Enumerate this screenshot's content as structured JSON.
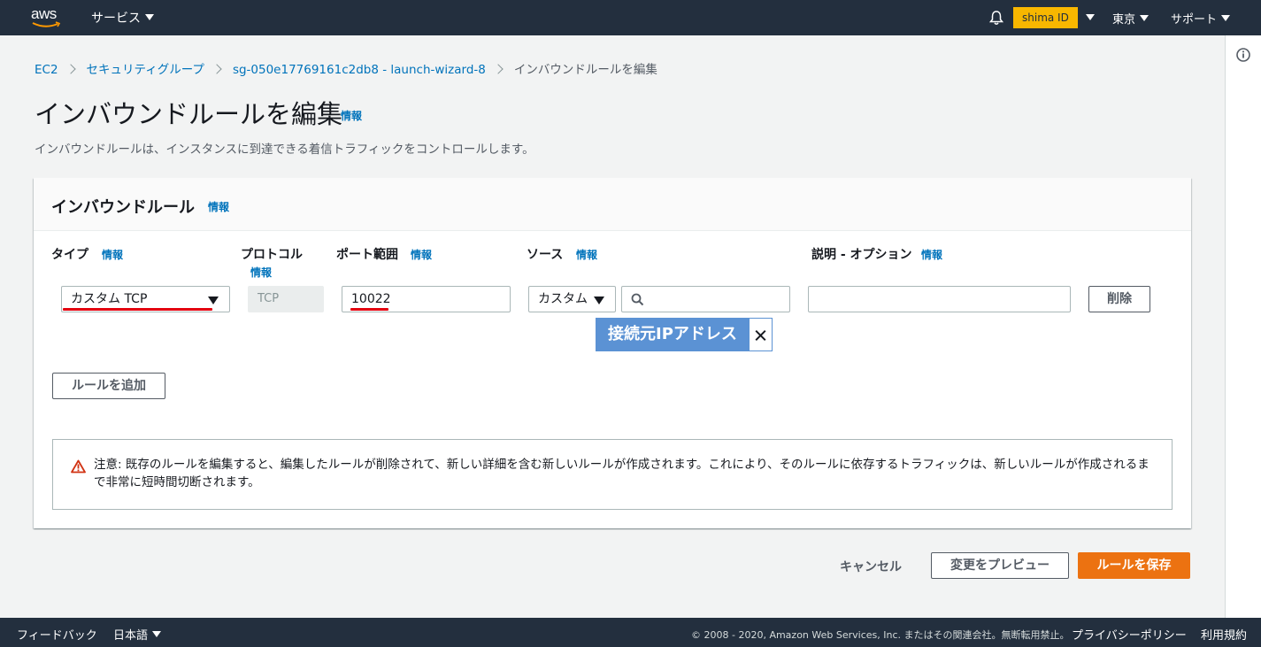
{
  "header": {
    "logo": "aws",
    "services": "サービス",
    "account": "shima ID",
    "region": "東京",
    "support": "サポート"
  },
  "breadcrumb": [
    "EC2",
    "セキュリティグループ",
    "sg-050e17769161c2db8 - launch-wizard-8",
    "インバウンドルールを編集"
  ],
  "page": {
    "title": "インバウンドルールを編集",
    "info": "情報",
    "description": "インバウンドルールは、インスタンスに到達できる着信トラフィックをコントロールします。"
  },
  "panel": {
    "title": "インバウンドルール",
    "info": "情報",
    "columns": {
      "type": "タイプ",
      "protocol": "プロトコル",
      "port_range": "ポート範囲",
      "source": "ソース",
      "description": "説明 - オプション",
      "info": "情報"
    },
    "rule": {
      "type": "カスタム TCP",
      "protocol": "TCP",
      "port_range": "10022",
      "source_type": "カスタム",
      "source_value": "",
      "description": "",
      "delete_label": "削除"
    },
    "annotation_tag": "接続元IPアドレス",
    "add_rule": "ルールを追加",
    "warning": "注意: 既存のルールを編集すると、編集したルールが削除されて、新しい詳細を含む新しいルールが作成されます。これにより、そのルールに依存するトラフィックは、新しいルールが作成されるまで非常に短時間切断されます。"
  },
  "actions": {
    "cancel": "キャンセル",
    "preview": "変更をプレビュー",
    "save": "ルールを保存"
  },
  "footer": {
    "feedback": "フィードバック",
    "language": "日本語",
    "copyright": "© 2008 - 2020, Amazon Web Services, Inc. またはその関連会社。無断転用禁止。",
    "privacy": "プライバシーポリシー",
    "terms": "利用規約"
  },
  "colors": {
    "nav": "#232f3e",
    "link": "#0073bb",
    "primary": "#ec7211",
    "account_badge": "#f8b700",
    "annotation_tag": "#5b92d4",
    "warning_icon": "#d13212",
    "underline": "#e3000f"
  },
  "icons": [
    "bell-icon",
    "info-circle-icon",
    "search-icon",
    "warning-icon",
    "close-icon"
  ]
}
